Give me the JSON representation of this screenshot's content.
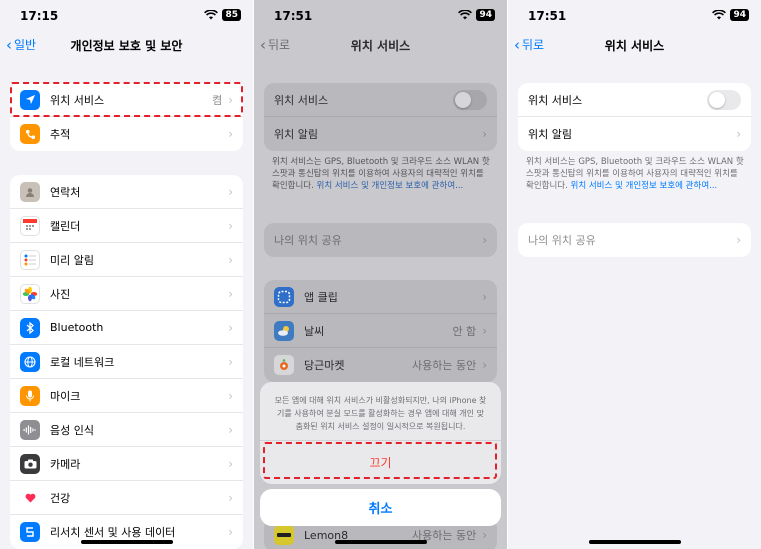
{
  "panel1": {
    "time": "17:15",
    "battery": "85",
    "back_label": "일반",
    "title": "개인정보 보호 및 보안",
    "group_top": [
      {
        "label": "위치 서비스",
        "value": "켬",
        "icon": "location-arrow-icon",
        "color": "#007aff"
      },
      {
        "label": "추적",
        "value": "",
        "icon": "tracking-icon",
        "color": "#ff9500"
      }
    ],
    "group_apps": [
      {
        "label": "연락처",
        "icon": "contacts-icon",
        "color": "#c8c1b8"
      },
      {
        "label": "캘린더",
        "icon": "calendar-icon",
        "color": "#ffffff"
      },
      {
        "label": "미리 알림",
        "icon": "reminders-icon",
        "color": "#ffffff"
      },
      {
        "label": "사진",
        "icon": "photos-icon",
        "color": "#ffffff"
      },
      {
        "label": "Bluetooth",
        "icon": "bluetooth-icon",
        "color": "#007aff"
      },
      {
        "label": "로컬 네트워크",
        "icon": "local-network-icon",
        "color": "#007aff"
      },
      {
        "label": "마이크",
        "icon": "microphone-icon",
        "color": "#ff9500"
      },
      {
        "label": "음성 인식",
        "icon": "speech-recognition-icon",
        "color": "#8e8e93"
      },
      {
        "label": "카메라",
        "icon": "camera-icon",
        "color": "#3a3a3c"
      },
      {
        "label": "건강",
        "icon": "health-heart-icon",
        "color": "#ffffff"
      },
      {
        "label": "리서치 센서 및 사용 데이터",
        "icon": "research-icon",
        "color": "#007aff"
      }
    ]
  },
  "panel2": {
    "time": "17:51",
    "battery": "94",
    "back_label": "뒤로",
    "title": "위치 서비스",
    "toggle_label": "위치 서비스",
    "alerts_label": "위치 알림",
    "desc_text": "위치 서비스는 GPS, Bluetooth 및 크라우드 소스 WLAN 핫스팟과 통신탑의 위치를 이용하여 사용자의 대략적인 위치를 확인합니다.",
    "desc_link": "위치 서비스 및 개인정보 보호에 관하여...",
    "share_label": "나의 위치 공유",
    "apps": [
      {
        "label": "앱 클립",
        "value": "",
        "icon": "app-clips-icon",
        "color": "#007aff"
      },
      {
        "label": "날씨",
        "value": "안 함",
        "icon": "weather-icon",
        "color": "#4a90d9"
      },
      {
        "label": "당근마켓",
        "value": "사용하는 동안",
        "icon": "carrot-icon",
        "color": "#ffffff"
      }
    ],
    "sheet_message": "모든 앱에 대해 위치 서비스가 비활성화되지만, 나의 iPhone 찾기를 사용하여 분실 모드를 활성화하는 경우 앱에 대해 개인 맞춤화된 위치 서비스 설정이 일시적으로 복원됩니다.",
    "sheet_off_label": "끄기",
    "cancel_label": "취소",
    "bottom_app": {
      "label": "Lemon8",
      "value": "사용하는 동안",
      "icon": "lemon8-icon",
      "color": "#f5e12a"
    }
  },
  "panel3": {
    "time": "17:51",
    "battery": "94",
    "back_label": "뒤로",
    "title": "위치 서비스",
    "toggle_label": "위치 서비스",
    "alerts_label": "위치 알림",
    "desc_text": "위치 서비스는 GPS, Bluetooth 및 크라우드 소스 WLAN 핫스팟과 통신탑의 위치를 이용하여 사용자의 대략적인 위치를 확인합니다.",
    "desc_link": "위치 서비스 및 개인정보 보호에 관하여...",
    "share_label": "나의 위치 공유"
  },
  "icons": {
    "chevron": "›",
    "back_chevron": "‹",
    "wifi": "wifi-icon",
    "battery": "battery-icon"
  },
  "colors": {
    "accent": "#007aff",
    "destructive": "#ff3b30",
    "highlight_dash": "#e4202a"
  }
}
